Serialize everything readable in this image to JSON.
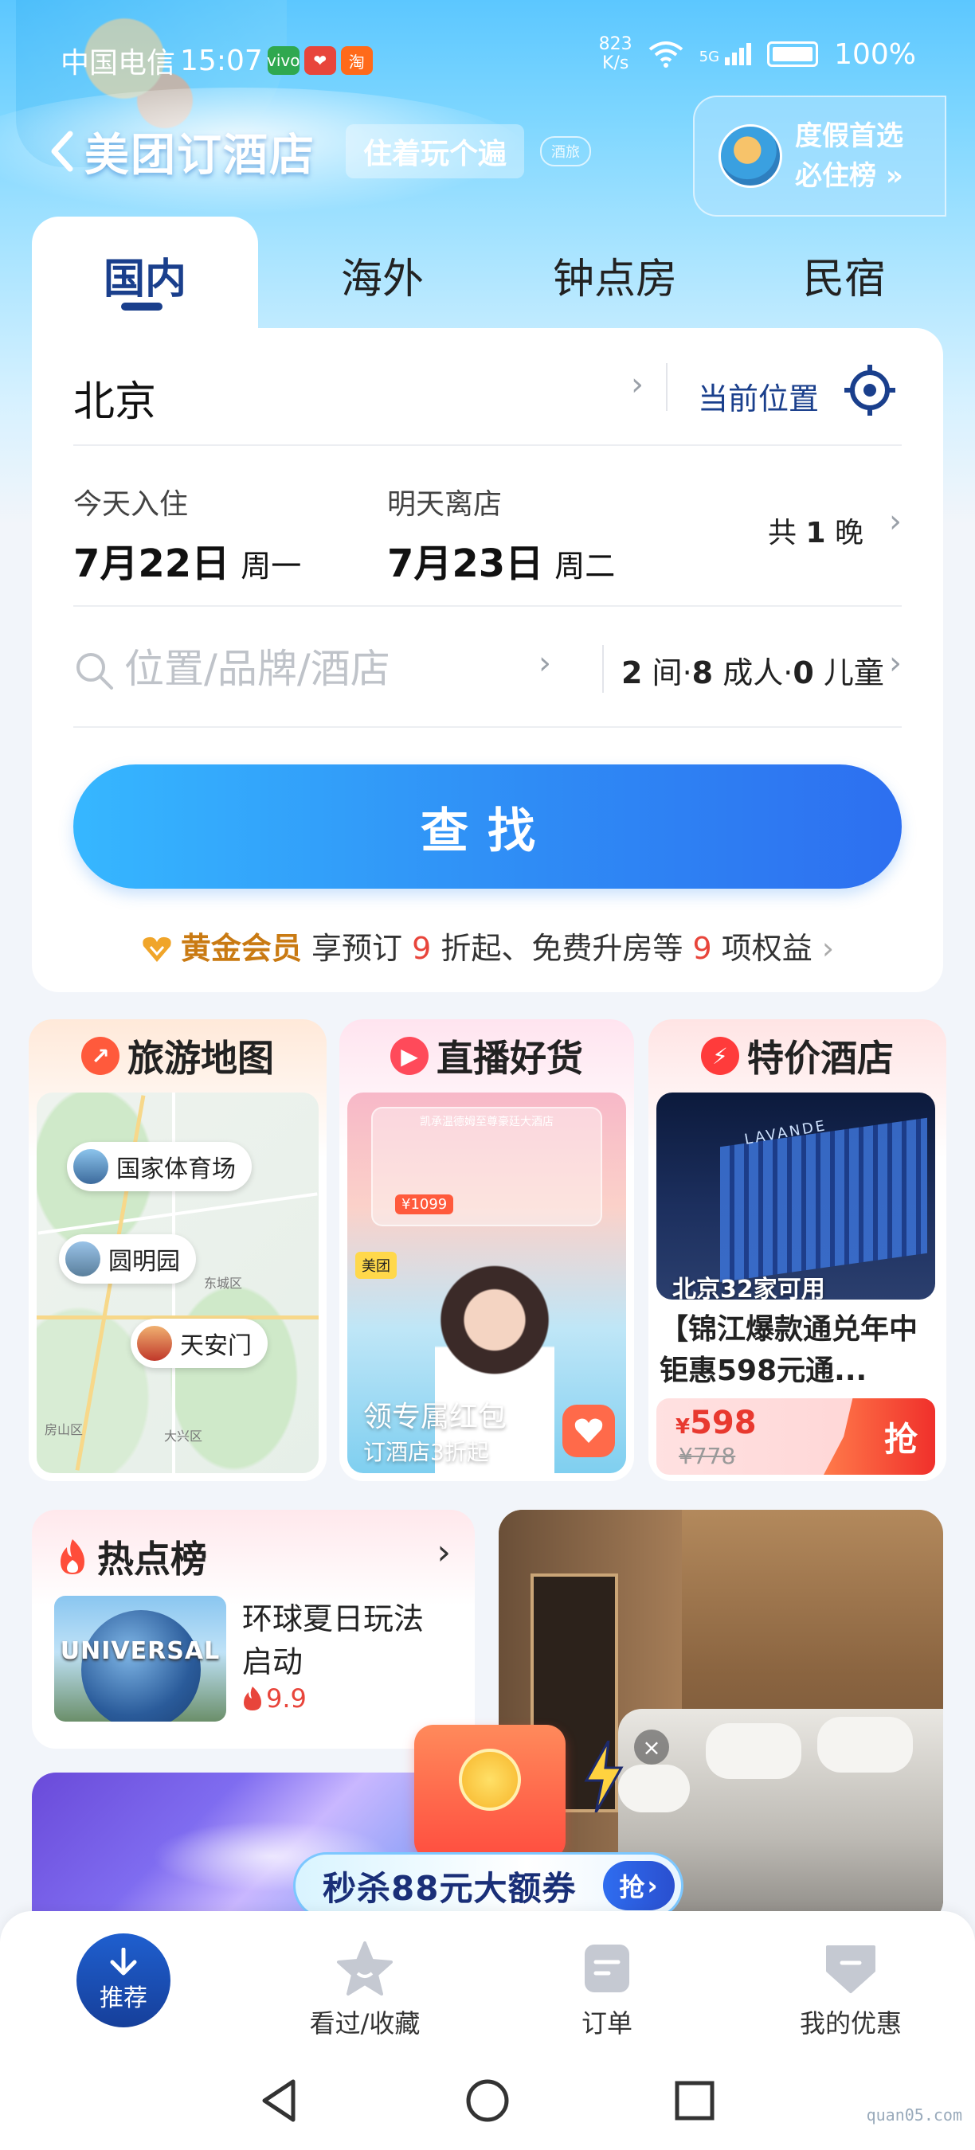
{
  "status_bar": {
    "carrier": "中国电信",
    "time": "15:07",
    "net_speed_value": "823",
    "net_speed_unit": "K/s",
    "signal": "5G",
    "battery": "100%",
    "mini_apps": [
      "vivo",
      "❤",
      "淘"
    ]
  },
  "header": {
    "title": "美团订酒店",
    "slogan": "住着玩个遍",
    "slogan_sub": "酒旅",
    "vacation_line1": "度假首选",
    "vacation_line2": "必住榜 »"
  },
  "tabs": [
    {
      "label": "国内",
      "active": true
    },
    {
      "label": "海外",
      "active": false
    },
    {
      "label": "钟点房",
      "active": false
    },
    {
      "label": "民宿",
      "active": false
    }
  ],
  "search": {
    "city": "北京",
    "current_location": "当前位置",
    "checkin_label": "今天入住",
    "checkin_date": "7月22日",
    "checkin_weekday": "周一",
    "checkout_label": "明天离店",
    "checkout_date": "7月23日",
    "checkout_weekday": "周二",
    "nights_prefix": "共",
    "nights_count": "1",
    "nights_suffix": "晚",
    "keyword_placeholder": "位置/品牌/酒店",
    "rooms": "2",
    "rooms_unit": "间",
    "adults": "8",
    "adults_unit": "成人",
    "children": "0",
    "children_unit": "儿童",
    "find_button": "查找"
  },
  "member": {
    "badge": "黄金会员",
    "text1": "享预订",
    "discount": "9",
    "text2": "折起、免费升房等",
    "benefits_count": "9",
    "text3": "项权益"
  },
  "features": {
    "travel_map": {
      "title": "旅游地图",
      "spots": [
        "国家体育场",
        "圆明园",
        "天安门"
      ],
      "map_labels": [
        "东城区",
        "大兴区",
        "房山区"
      ]
    },
    "live": {
      "title": "直播好货",
      "banner_text": "凯承温德姆至尊豪廷大酒店",
      "price": "¥1099",
      "badge": "美团",
      "label1": "领专属红包",
      "label2": "订酒店3折起"
    },
    "deal": {
      "title": "特价酒店",
      "hotel_sign": "LAVANDE",
      "available": "北京32家可用",
      "hotel_title": "【锦江爆款通兑年中钜惠598元通...",
      "price_symbol": "¥",
      "price": "598",
      "original_price": "¥778",
      "grab": "抢"
    }
  },
  "hot_list": {
    "title": "热点榜",
    "image_text": "UNIVERSAL",
    "item_text": "环球夏日玩法启动",
    "score": "9.9"
  },
  "promo": {
    "coupon_text": "秒杀88元大额券",
    "coupon_button": "抢"
  },
  "bottom_nav": [
    {
      "label": "推荐",
      "active": true
    },
    {
      "label": "看过/收藏",
      "active": false
    },
    {
      "label": "订单",
      "active": false
    },
    {
      "label": "我的优惠",
      "active": false
    }
  ],
  "watermark": "quan05.com",
  "colors": {
    "primary": "#1a3f8c",
    "accent_blue": "#2f8cf5",
    "gold": "#c97a12",
    "red": "#e8453b"
  }
}
